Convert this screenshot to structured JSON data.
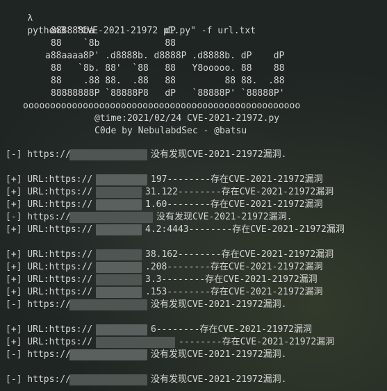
{
  "prompt": {
    "symbol": "λ",
    "command": "python3  \"CVE-2021-21972 p1.py\" -f url.txt"
  },
  "banner": {
    "lines": [
      "888888ba             dP",
      "88    `8b            88",
      "a88aaaa8P' .d8888b. d8888P .d8888b. dP    dP",
      "88   `8b. 88'  `88   88   Y8ooooo. 88    88",
      "88    .88 88.  .88   88         88 88.  .88",
      "88888888P `88888P8   dP   `88888P' `88888P'",
      "ooooooooooooooooooooooooooooooooooooooooooooooooooo",
      "@time:2021/02/24 CVE-2021-21972.py",
      "C0de by NebulabdSec - @batsu"
    ]
  },
  "output": {
    "rows": [
      {
        "prefix": "[-] https://",
        "suffix": "没有发现CVE-2021-21972漏洞."
      },
      {
        "prefix": "[+] URL:https://",
        "suffix": "197--------存在CVE-2021-21972漏洞"
      },
      {
        "prefix": "[+] URL:https://",
        "suffix": "31.122--------存在CVE-2021-21972漏洞"
      },
      {
        "prefix": "[+] URL:https://",
        "suffix": "1.60--------存在CVE-2021-21972漏洞"
      },
      {
        "prefix": "[-] https://",
        "suffix": "没有发现CVE-2021-21972漏洞."
      },
      {
        "prefix": "[+] URL:https://",
        "suffix": "4.2:4443--------存在CVE-2021-21972漏洞"
      },
      {
        "prefix": "[+] URL:https://",
        "suffix": "38.162--------存在CVE-2021-21972漏洞"
      },
      {
        "prefix": "[+] URL:https://",
        "suffix": ".208--------存在CVE-2021-21972漏洞"
      },
      {
        "prefix": "[+] URL:https://",
        "suffix": "3.3--------存在CVE-2021-21972漏洞"
      },
      {
        "prefix": "[+] URL:https://",
        "suffix": ".153--------存在CVE-2021-21972漏洞"
      },
      {
        "prefix": "[-] https://",
        "suffix": "没有发现CVE-2021-21972漏洞."
      },
      {
        "prefix": "[+] URL:https://",
        "suffix": "6--------存在CVE-2021-21972漏洞"
      },
      {
        "prefix": "[+] URL:https://",
        "suffix": "--------存在CVE-2021-21972漏洞"
      },
      {
        "prefix": "[-] https://",
        "suffix": "没有发现CVE-2021-21972漏洞."
      },
      {
        "prefix": "[-] https://",
        "suffix": "没有发现CVE-2021-21972漏洞."
      }
    ]
  }
}
